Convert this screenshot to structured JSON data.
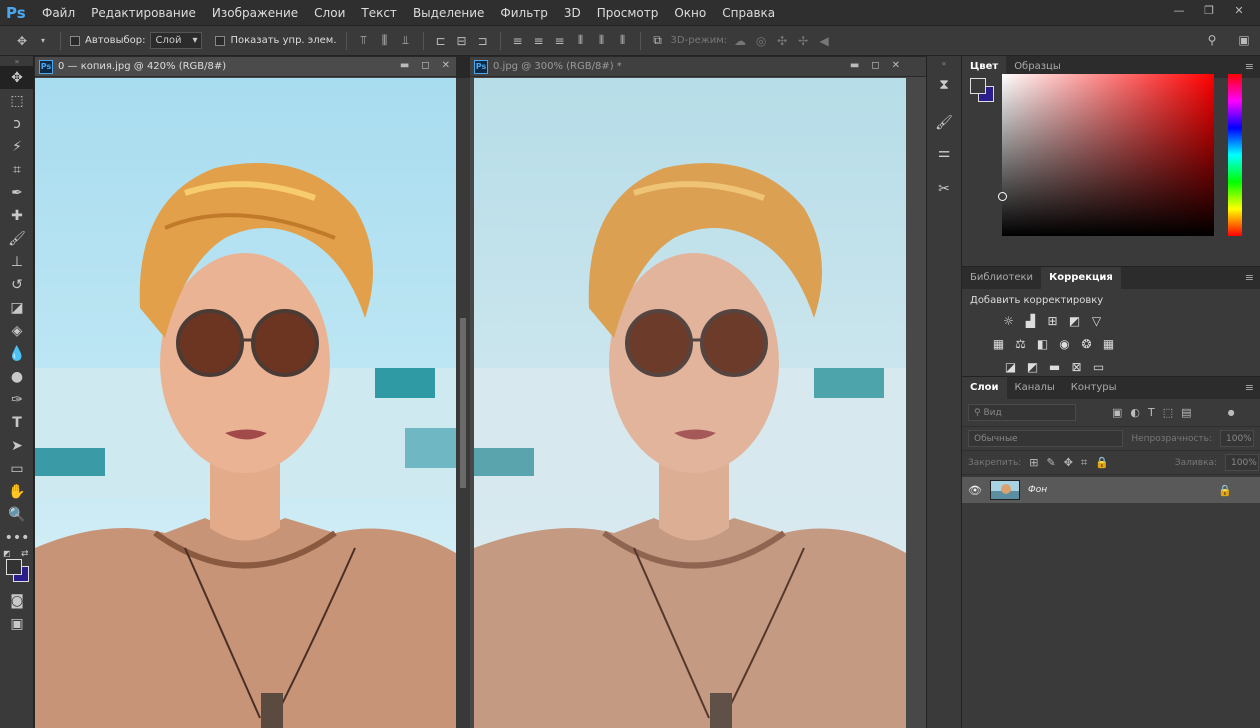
{
  "app": {
    "logo": "Ps"
  },
  "menu": [
    "Файл",
    "Редактирование",
    "Изображение",
    "Слои",
    "Текст",
    "Выделение",
    "Фильтр",
    "3D",
    "Просмотр",
    "Окно",
    "Справка"
  ],
  "options": {
    "autoselect_label": "Автовыбор:",
    "autoselect_value": "Слой",
    "show_controls_label": "Показать упр. элем.",
    "mode_3d_label": "3D-режим:"
  },
  "documents": [
    {
      "title": "0 — копия.jpg @ 420% (RGB/8#)",
      "active": true
    },
    {
      "title": "0.jpg @ 300% (RGB/8#) *",
      "active": false
    }
  ],
  "color_panel": {
    "tabs": [
      "Цвет",
      "Образцы"
    ],
    "active_tab": "Цвет",
    "foreground": "#3a3a3a",
    "background": "#2a1e8c"
  },
  "adjust_panel": {
    "tabs": [
      "Библиотеки",
      "Коррекция"
    ],
    "active_tab": "Коррекция",
    "title": "Добавить корректировку"
  },
  "layers_panel": {
    "tabs": [
      "Слои",
      "Каналы",
      "Контуры"
    ],
    "active_tab": "Слои",
    "filter_placeholder": "Вид",
    "blend_mode": "Обычные",
    "opacity_label": "Непрозрачность:",
    "opacity_value": "100%",
    "lock_label": "Закрепить:",
    "fill_label": "Заливка:",
    "fill_value": "100%",
    "layers": [
      {
        "name": "Фон",
        "visible": true,
        "locked": true
      }
    ]
  }
}
